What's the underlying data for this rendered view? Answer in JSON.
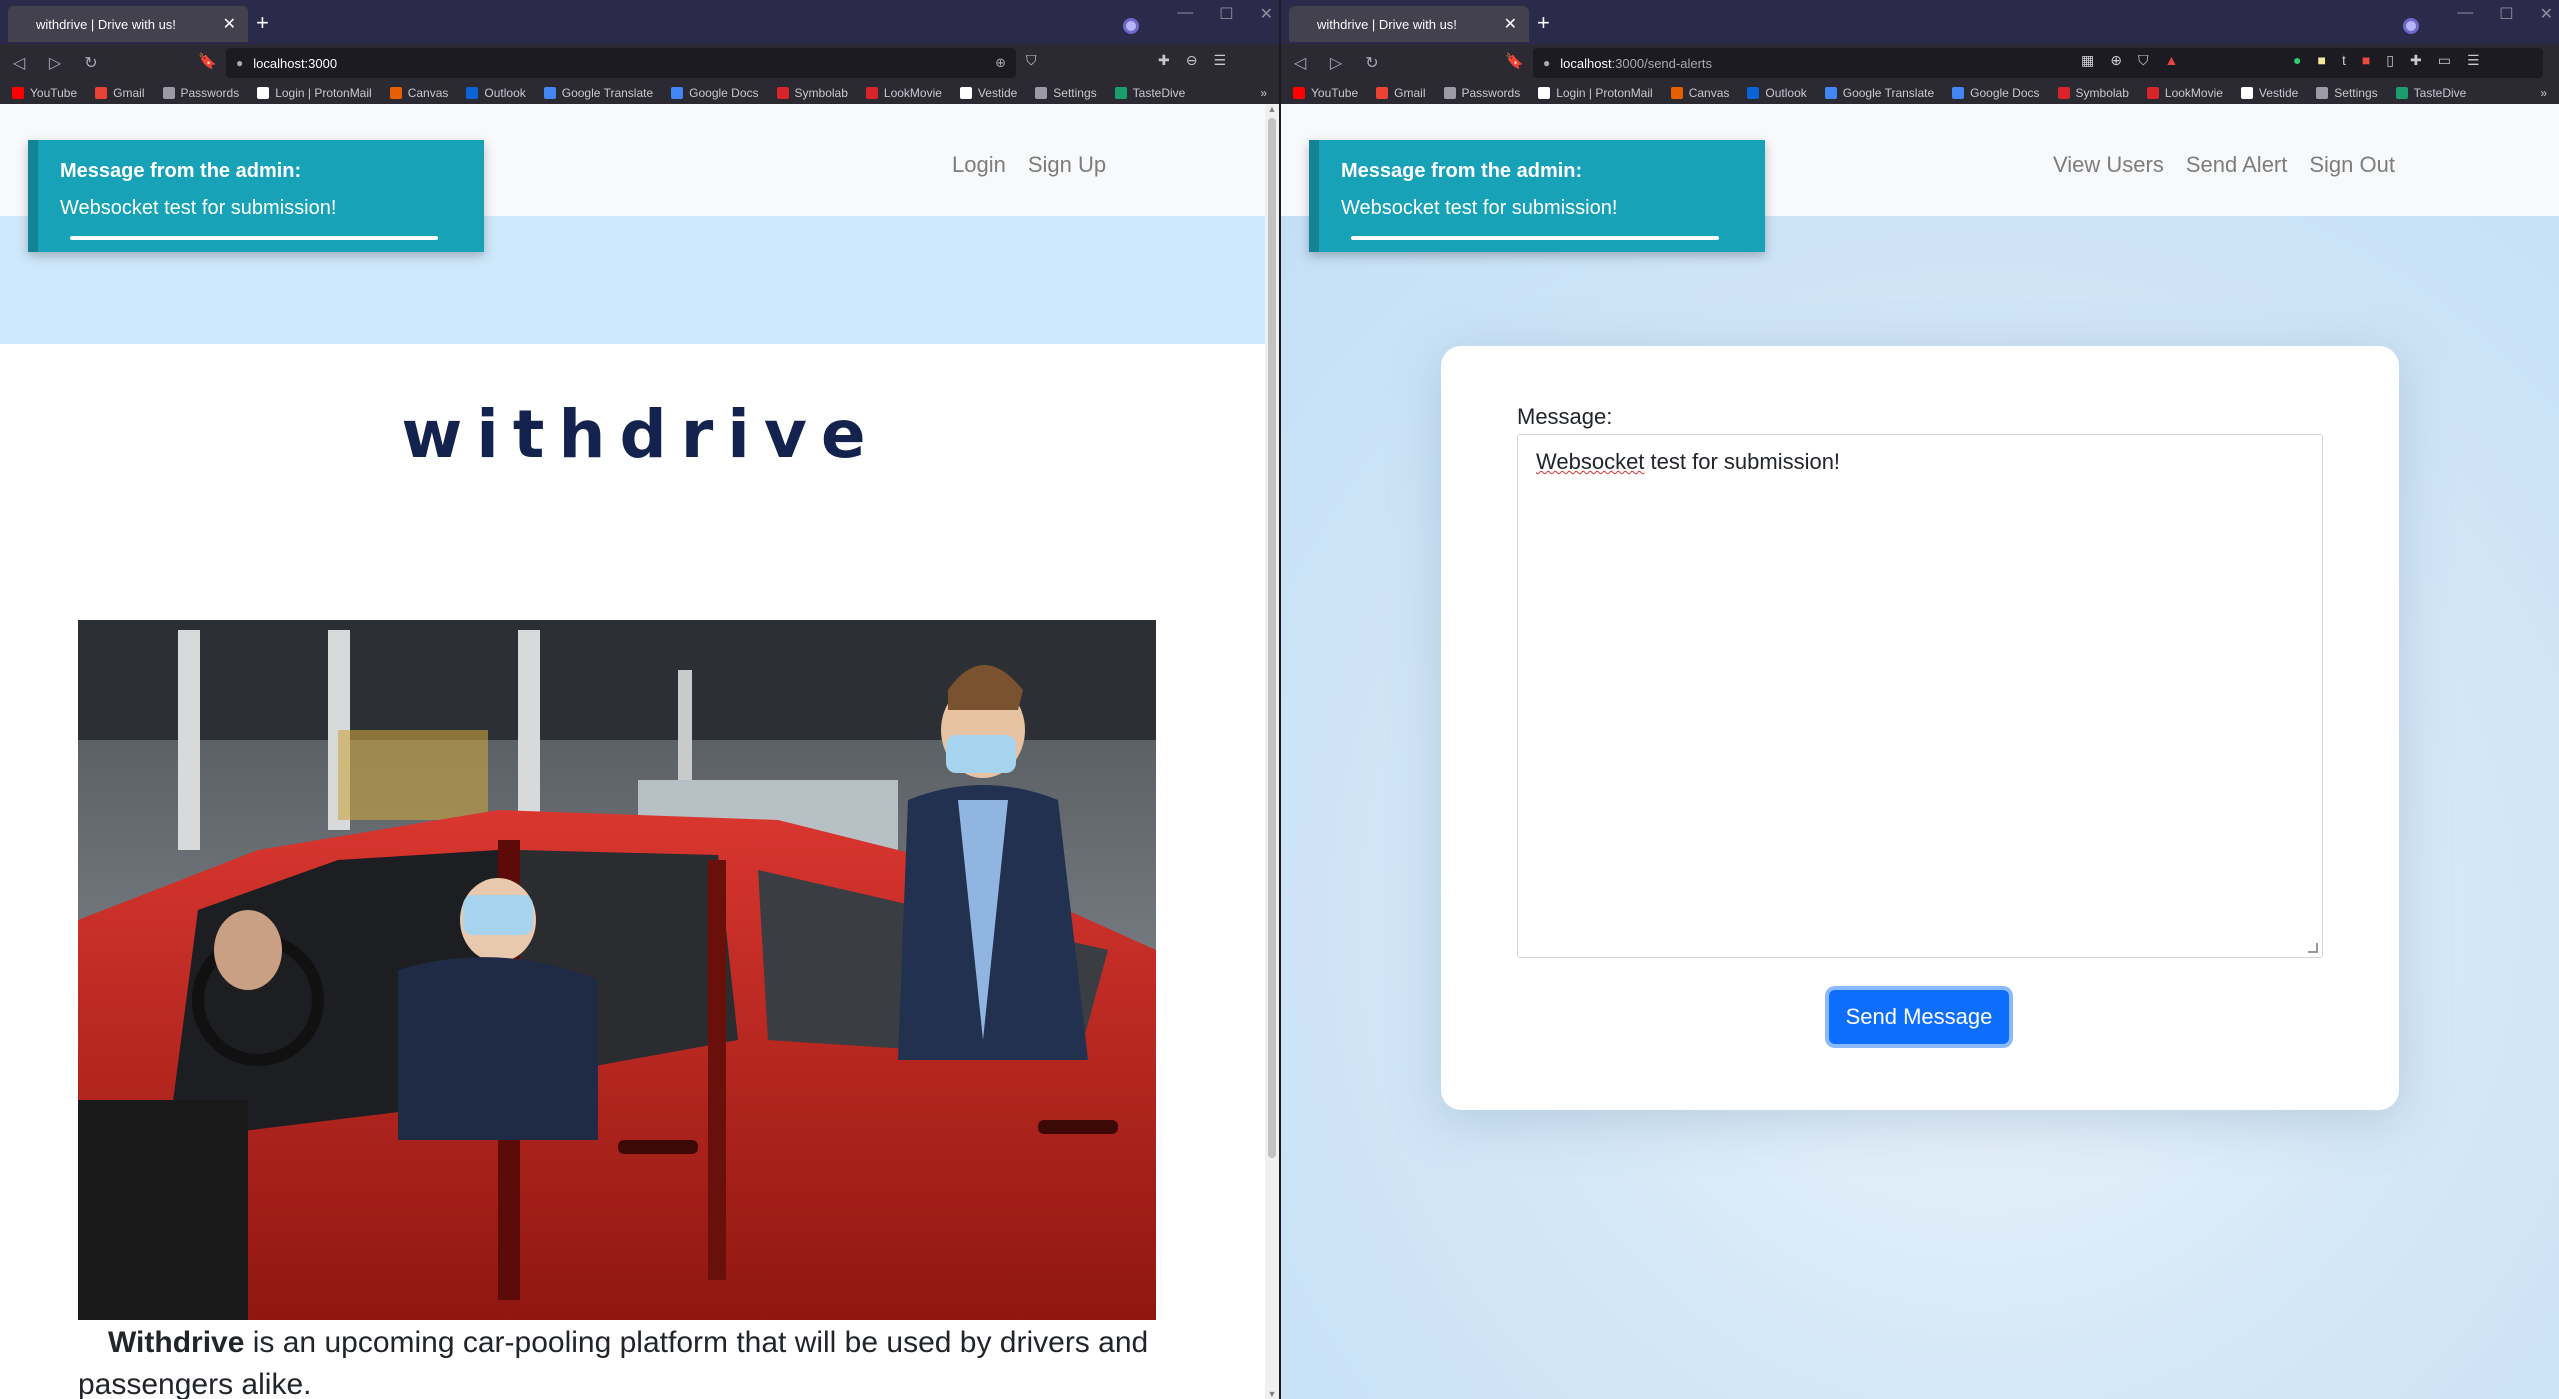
{
  "left_window": {
    "tab_title": "withdrive | Drive with us!",
    "url": "localhost:3000",
    "bookmarks": [
      {
        "label": "YouTube",
        "color": "#ff0000"
      },
      {
        "label": "Gmail",
        "color": "#ea4335"
      },
      {
        "label": "Passwords",
        "color": "#9b9ba8"
      },
      {
        "label": "Login | ProtonMail",
        "color": "#ffffff"
      },
      {
        "label": "Canvas",
        "color": "#e66000"
      },
      {
        "label": "Outlook",
        "color": "#0a64d6"
      },
      {
        "label": "Google Translate",
        "color": "#4285f4"
      },
      {
        "label": "Google Docs",
        "color": "#4285f4"
      },
      {
        "label": "Symbolab",
        "color": "#d8232a"
      },
      {
        "label": "LookMovie",
        "color": "#d8232a"
      },
      {
        "label": "Vestide",
        "color": "#ffffff"
      },
      {
        "label": "Settings",
        "color": "#9b9ba8"
      },
      {
        "label": "TasteDive",
        "color": "#1a9e6e"
      }
    ],
    "nav_links": [
      "Login",
      "Sign Up"
    ],
    "toast": {
      "title": "Message from the admin:",
      "body": "Websocket test for submission!"
    },
    "brand": "withdrive",
    "photo_alt": "icon",
    "about_brand": "Withdrive",
    "about_text": " is an upcoming car-pooling platform that will be used by drivers and passengers alike."
  },
  "right_window": {
    "tab_title": "withdrive | Drive with us!",
    "url_host": "localhost",
    "url_path": ":3000/send-alerts",
    "bookmarks": [
      {
        "label": "YouTube",
        "color": "#ff0000"
      },
      {
        "label": "Gmail",
        "color": "#ea4335"
      },
      {
        "label": "Passwords",
        "color": "#9b9ba8"
      },
      {
        "label": "Login | ProtonMail",
        "color": "#ffffff"
      },
      {
        "label": "Canvas",
        "color": "#e66000"
      },
      {
        "label": "Outlook",
        "color": "#0a64d6"
      },
      {
        "label": "Google Translate",
        "color": "#4285f4"
      },
      {
        "label": "Google Docs",
        "color": "#4285f4"
      },
      {
        "label": "Symbolab",
        "color": "#d8232a"
      },
      {
        "label": "LookMovie",
        "color": "#d8232a"
      },
      {
        "label": "Vestide",
        "color": "#ffffff"
      },
      {
        "label": "Settings",
        "color": "#9b9ba8"
      },
      {
        "label": "TasteDive",
        "color": "#1a9e6e"
      }
    ],
    "nav_links": [
      "View Users",
      "Send Alert",
      "Sign Out"
    ],
    "toast": {
      "title": "Message from the admin:",
      "body": "Websocket test for submission!"
    },
    "form": {
      "label": "Message:",
      "value_misspelled": "Websocket",
      "value_rest": " test for submission!",
      "button": "Send Message"
    }
  },
  "colors": {
    "toast_bg": "#17a2b8",
    "brand": "#14234d",
    "primary_button": "#0d6efd",
    "tab_bar": "#2b2a4a"
  }
}
